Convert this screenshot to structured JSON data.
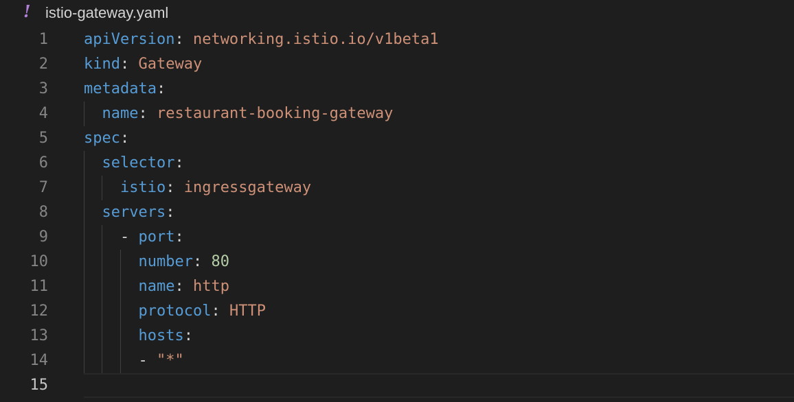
{
  "tab": {
    "icon": "yaml-exclamation-icon",
    "icon_glyph": "!",
    "filename": "istio-gateway.yaml"
  },
  "colors": {
    "background": "#1e1e1e",
    "key": "#569cd6",
    "string": "#ce9178",
    "number": "#b5cea8",
    "punctuation": "#d4d4d4",
    "line_number": "#858585",
    "icon": "#b180d7"
  },
  "editor": {
    "current_line": "15",
    "lines": [
      {
        "number": "1",
        "indent": "",
        "dash": "",
        "key": "apiVersion",
        "sep": ": ",
        "value": "networking.istio.io/v1beta1",
        "value_type": "str"
      },
      {
        "number": "2",
        "indent": "",
        "dash": "",
        "key": "kind",
        "sep": ": ",
        "value": "Gateway",
        "value_type": "str"
      },
      {
        "number": "3",
        "indent": "",
        "dash": "",
        "key": "metadata",
        "sep": ":",
        "value": "",
        "value_type": "str"
      },
      {
        "number": "4",
        "indent": "  ",
        "dash": "",
        "key": "name",
        "sep": ": ",
        "value": "restaurant-booking-gateway",
        "value_type": "str"
      },
      {
        "number": "5",
        "indent": "",
        "dash": "",
        "key": "spec",
        "sep": ":",
        "value": "",
        "value_type": "str"
      },
      {
        "number": "6",
        "indent": "  ",
        "dash": "",
        "key": "selector",
        "sep": ":",
        "value": "",
        "value_type": "str"
      },
      {
        "number": "7",
        "indent": "    ",
        "dash": "",
        "key": "istio",
        "sep": ": ",
        "value": "ingressgateway",
        "value_type": "str"
      },
      {
        "number": "8",
        "indent": "  ",
        "dash": "",
        "key": "servers",
        "sep": ":",
        "value": "",
        "value_type": "str"
      },
      {
        "number": "9",
        "indent": "    ",
        "dash": "- ",
        "key": "port",
        "sep": ":",
        "value": "",
        "value_type": "str"
      },
      {
        "number": "10",
        "indent": "      ",
        "dash": "",
        "key": "number",
        "sep": ": ",
        "value": "80",
        "value_type": "num"
      },
      {
        "number": "11",
        "indent": "      ",
        "dash": "",
        "key": "name",
        "sep": ": ",
        "value": "http",
        "value_type": "str"
      },
      {
        "number": "12",
        "indent": "      ",
        "dash": "",
        "key": "protocol",
        "sep": ": ",
        "value": "HTTP",
        "value_type": "str"
      },
      {
        "number": "13",
        "indent": "      ",
        "dash": "",
        "key": "hosts",
        "sep": ":",
        "value": "",
        "value_type": "str"
      },
      {
        "number": "14",
        "indent": "      ",
        "dash": "- ",
        "key": "",
        "sep": "",
        "value": "\"*\"",
        "value_type": "str"
      },
      {
        "number": "15",
        "indent": "",
        "dash": "",
        "key": "",
        "sep": "",
        "value": "",
        "value_type": "str"
      }
    ]
  }
}
